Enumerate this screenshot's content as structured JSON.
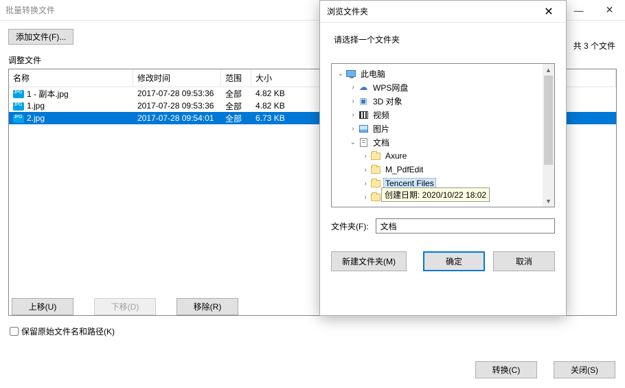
{
  "window": {
    "title": "批量转换文件"
  },
  "main": {
    "add_file_btn": "添加文件(F)...",
    "count_text": "共 3 个文件",
    "group_label": "调整文件",
    "columns": {
      "name": "名称",
      "mtime": "修改时间",
      "scope": "范围",
      "size": "大小"
    },
    "rows": [
      {
        "name": "1 - 副本.jpg",
        "mtime": "2017-07-28 09:53:36",
        "scope": "全部",
        "size": "4.82 KB",
        "selected": false
      },
      {
        "name": "1.jpg",
        "mtime": "2017-07-28 09:53:36",
        "scope": "全部",
        "size": "4.82 KB",
        "selected": false
      },
      {
        "name": "2.jpg",
        "mtime": "2017-07-28 09:54:01",
        "scope": "全部",
        "size": "6.73 KB",
        "selected": true
      }
    ],
    "move_up": "上移(U)",
    "move_down": "下移(D)",
    "remove": "移除(R)",
    "keep_original_label": "保留原始文件名和路径(K)",
    "convert": "转换(C)",
    "close": "关闭(S)"
  },
  "dialog": {
    "title": "浏览文件夹",
    "instruction": "请选择一个文件夹",
    "tree": [
      {
        "depth": 0,
        "expander": "v",
        "icon": "monitor",
        "label": "此电脑"
      },
      {
        "depth": 1,
        "expander": ">",
        "icon": "cloud",
        "label": "WPS网盘"
      },
      {
        "depth": 1,
        "expander": ">",
        "icon": "cube",
        "label": "3D 对象"
      },
      {
        "depth": 1,
        "expander": ">",
        "icon": "film",
        "label": "视频"
      },
      {
        "depth": 1,
        "expander": ">",
        "icon": "pic",
        "label": "图片"
      },
      {
        "depth": 1,
        "expander": "v",
        "icon": "doc",
        "label": "文档"
      },
      {
        "depth": 2,
        "expander": ">",
        "icon": "folder",
        "label": "Axure"
      },
      {
        "depth": 2,
        "expander": ">",
        "icon": "folder",
        "label": "M_PdfEdit"
      },
      {
        "depth": 2,
        "expander": ">",
        "icon": "folder",
        "label": "Tencent Files",
        "selected": true
      },
      {
        "depth": 2,
        "expander": ">",
        "icon": "folder",
        "label": ""
      }
    ],
    "tooltip": "创建日期: 2020/10/22 18:02",
    "path_label": "文件夹(F):",
    "path_value": "文档",
    "new_folder": "新建文件夹(M)",
    "ok": "确定",
    "cancel": "取消"
  }
}
